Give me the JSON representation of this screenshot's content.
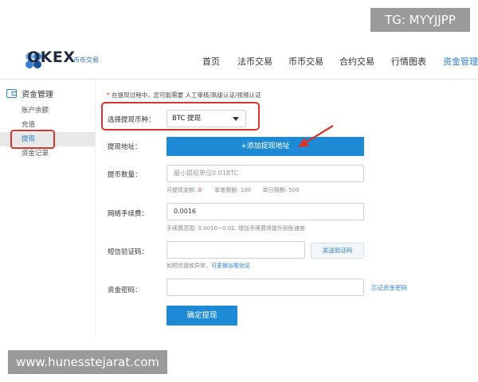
{
  "watermarks": {
    "tg": "TG: MYYJJPP",
    "site": "www.hunesstejarat.com"
  },
  "brand": {
    "logo_text": "OKEX",
    "sub": "币币交易"
  },
  "nav": {
    "items": [
      "首页",
      "法币交易",
      "币币交易",
      "合约交易",
      "行情图表",
      "资金管理"
    ],
    "active_index": 5
  },
  "sidebar": {
    "heading": "资金管理",
    "items": [
      "账户余额",
      "充值",
      "提现",
      "资金记录"
    ],
    "active_index": 2
  },
  "form": {
    "notice_star": "*",
    "notice": "在提现过程中，您可能需要 人工审核/高级认证/视频认证",
    "currency_label": "选择提现币种：",
    "currency_value": "BTC 提现",
    "address_label": "提现地址：",
    "add_address_button": "+添加提现地址",
    "amount_label": "提币数量：",
    "amount_placeholder": "最小提现单位0.01BTC",
    "available_label": "可提现金额:",
    "available_value": "0",
    "single_limit": "单笔限额: 100",
    "daily_limit": "单日限额: 500",
    "fee_label": "网络手续费：",
    "fee_value": "0.0016",
    "fee_hint": "手续费范围: 0.0016~0.02, 增加手续费将提升到账速度",
    "sms_label": "短信验证码：",
    "send_code_button": "发送验证码",
    "sms_hint_prefix": "如短信接收异常，",
    "sms_hint_link": "可更换谷歌验证",
    "password_label": "资金密码：",
    "forgot_password": "忘记资金密码",
    "submit_button": "确定提现"
  },
  "colors": {
    "accent": "#1e8ad6",
    "highlight_box": "#d9342b",
    "link": "#2c7fd4"
  }
}
